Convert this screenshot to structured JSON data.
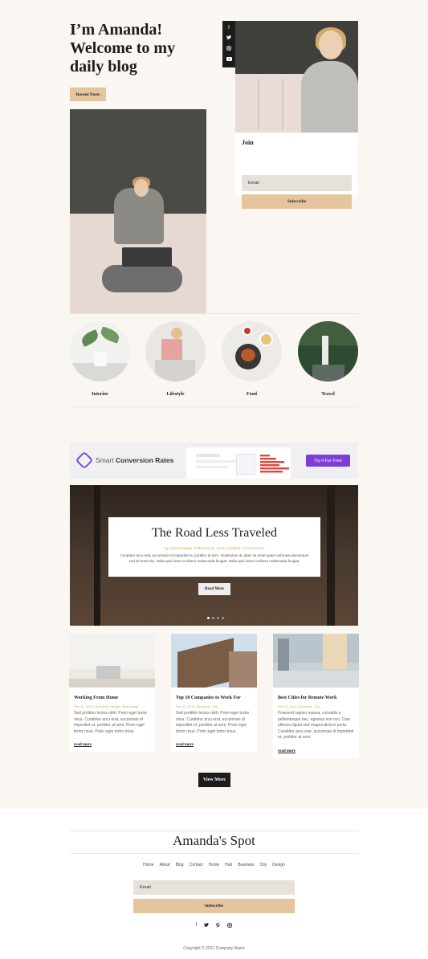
{
  "hero": {
    "title": "I’m Amanda!\nWelcome to my\ndaily blog",
    "recent_button": "Recent Posts"
  },
  "social": [
    "f",
    "t",
    "ig",
    "yt"
  ],
  "join": {
    "label": "Join",
    "email_placeholder": "Email",
    "subscribe": "Subscribe"
  },
  "categories": [
    {
      "label": "Interior"
    },
    {
      "label": "Lifestyle"
    },
    {
      "label": "Food"
    },
    {
      "label": "Travel"
    }
  ],
  "ad": {
    "text_light": "Smart ",
    "text_bold": "Conversion Rates",
    "button": "Try it For Free"
  },
  "slider": {
    "title": "The Road Less Traveled",
    "meta": "by pack template | February 12, 2019 | Outdoor | 0 Comments",
    "excerpt": "Curabitur arcu erat, accumsan id imperdiet et, porttitor at sem. Vestibulum ac diam sit amet quam vehicula elementum sed sit amet dui. Nulla quis lorem ut libero malesuada feugiat. Nulla quis lorem ut libero malesuada feugiat.",
    "button": "Read More"
  },
  "posts": [
    {
      "title": "Working From Home",
      "meta": "Feb 12, 2019 | Business, Design, Technology",
      "excerpt": "Sed porttitor lectus nibh. Proin eget tortor risus. Curabitur arcu erat, accumsan id imperdiet et, porttitor at sem. Proin eget tortor risus. Proin eget tortor risus.",
      "more": "read more"
    },
    {
      "title": "Top 10 Companies to Work For",
      "meta": "Feb 12, 2019 | Business, City",
      "excerpt": "Sed porttitor lectus nibh. Proin eget tortor risus. Curabitur arcu erat, accumsan id imperdiet et, porttitor at sem. Proin eget tortor risus. Proin eget tortor risus.",
      "more": "read more"
    },
    {
      "title": "Best Cities for Remote Work",
      "meta": "Feb 12, 2019 | Business, City",
      "excerpt": "Praesent sapien massa, convallis a pellentesque nec, egestas non nisi. Cras ultricies ligula sed magna dictum porta. Curabitur arcu erat, accumsan id imperdiet et, porttitor at sem.",
      "more": "read more"
    }
  ],
  "view_more": "View More",
  "footer": {
    "title": "Amanda's Spot",
    "nav": [
      "Home",
      "About",
      "Blog",
      "Contact",
      "Home",
      "Hub",
      "Business",
      "City",
      "Design"
    ],
    "email_placeholder": "Email",
    "subscribe": "Subscribe",
    "social": [
      "f",
      "t",
      "p",
      "ig"
    ],
    "copyright": "Copyright © 2021 Company Name"
  }
}
